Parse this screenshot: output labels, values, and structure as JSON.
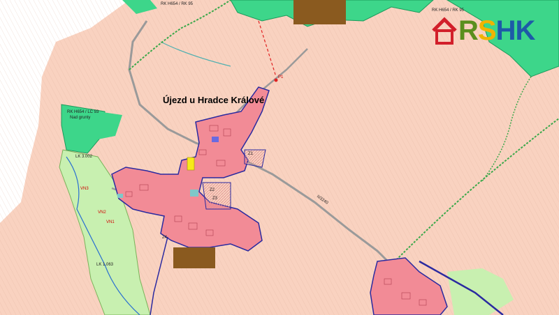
{
  "map": {
    "place_name": "Újezd u Hradce Králové",
    "road_label": "II/3240",
    "labels": {
      "rk_top": "RK H654 / RK 95",
      "rk_top_right": "RK H654 / RK 95",
      "rk_left": "RK H654 / LC 93",
      "rk_left_sub": "Nad grunty",
      "lc_bottom": "LK 1.063",
      "lc_left": "LK 3.002",
      "plot_a": "Z1",
      "plot_b": "P1",
      "plot_c": "Z2",
      "plot_d": "Z3",
      "plot_e": "Z4",
      "plot_f": "VN2",
      "plot_g": "VN1",
      "plot_h": "VN3"
    },
    "colors": {
      "agricultural": "#f9d2c0",
      "settlement": "#f28b96",
      "forest": "#3dd68a",
      "brown_area": "#8a5a1f",
      "meadow": "#c8f0b0",
      "water": "#7ec8c8",
      "boundary": "#2a2aa0"
    }
  },
  "logo": {
    "letters": [
      "R",
      "S",
      "H",
      "K"
    ],
    "icon": "house-icon"
  }
}
